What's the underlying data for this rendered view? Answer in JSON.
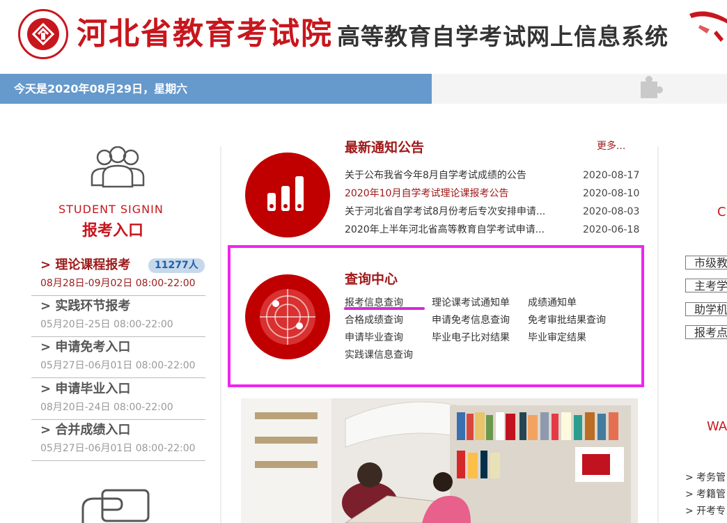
{
  "header": {
    "site_name": "河北省教育考试院",
    "system_name": "高等教育自学考试网上信息系统"
  },
  "datebar": {
    "text": "今天是2020年08月29日，星期六"
  },
  "signin": {
    "title_en": "STUDENT SIGNIN",
    "title_cn": "报考入口",
    "entries": [
      {
        "label": "> 理论课程报考",
        "badge": "11277人",
        "time": "08月28日-09月02日 08:00-22:00",
        "active": true
      },
      {
        "label": "> 实践环节报考",
        "time": "05月20日-25日 08:00-22:00"
      },
      {
        "label": "> 申请免考入口",
        "time": "05月27日-06月01日 08:00-22:00"
      },
      {
        "label": "> 申请毕业入口",
        "time": "08月20日-24日 08:00-22:00"
      },
      {
        "label": "> 合并成绩入口",
        "time": "05月27日-06月01日 08:00-22:00"
      }
    ]
  },
  "notices": {
    "title": "最新通知公告",
    "more": "更多...",
    "items": [
      {
        "title": "关于公布我省今年8月自学考试成绩的公告",
        "date": "2020-08-17"
      },
      {
        "title": "2020年10月自学考试理论课报考公告",
        "date": "2020-08-10"
      },
      {
        "title": "关于河北省自学考试8月份考后专次安排申请...",
        "date": "2020-08-03"
      },
      {
        "title": "2020年上半年河北省高等教育自学考试申请...",
        "date": "2020-06-18"
      }
    ]
  },
  "query": {
    "title": "查询中心",
    "links": [
      "报考信息查询",
      "理论课考试通知单",
      "成绩通知单",
      "合格成绩查询",
      "申请免考信息查询",
      "免考审批结果查询",
      "申请毕业查询",
      "毕业电子比对结果",
      "毕业审定结果",
      "实践课信息查询"
    ]
  },
  "right": {
    "frag_top": "C",
    "buttons": [
      "市级教",
      "主考学",
      "助学机",
      "报考点"
    ],
    "frag_mid": "WA",
    "links": [
      "> 考务管",
      "> 考籍管",
      "> 开考专"
    ]
  },
  "colors": {
    "brand_red": "#c8161d",
    "circle_red": "#c00000",
    "datebar_blue": "#6699cc",
    "highlight_magenta": "#f024f0"
  }
}
